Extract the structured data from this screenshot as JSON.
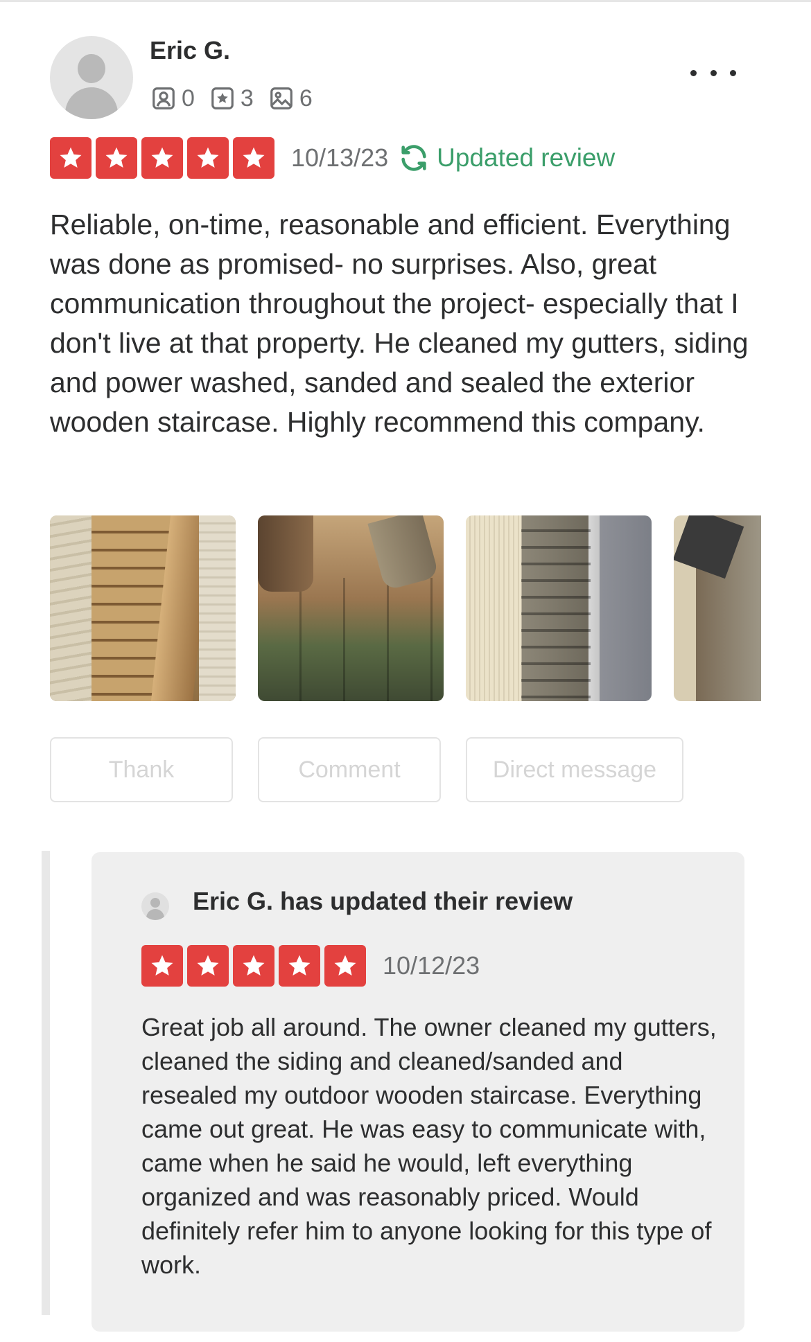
{
  "review": {
    "user": {
      "name": "Eric G.",
      "friends_count": "0",
      "reviews_count": "3",
      "photos_count": "6"
    },
    "rating": 5,
    "date": "10/13/23",
    "updated_label": "Updated review",
    "text": "Reliable, on-time, reasonable and efficient. Everything was done as promised- no surprises. Also, great communication throughout the project- especially that I don't live at that property. He cleaned my gutters, siding and power washed, sanded and sealed the exterior wooden staircase. Highly recommend this company.",
    "actions": {
      "thank": "Thank",
      "comment": "Comment",
      "direct_message": "Direct message"
    }
  },
  "previous_review": {
    "title": "Eric G. has updated their review",
    "rating": 5,
    "date": "10/12/23",
    "text": "Great job all around. The owner cleaned my gutters, cleaned the siding and cleaned/sanded and resealed my outdoor wooden staircase. Everything came out great. He was easy to communicate with, came when he said he would, left everything organized and was reasonably priced. Would definitely refer him to anyone looking for this type of work."
  },
  "colors": {
    "star_red": "#e3413f",
    "updated_green": "#3b9e6a",
    "muted_text": "#6e7072",
    "button_text_disabled": "#d5d5d5"
  },
  "icons": {
    "friends": "friends-icon",
    "reviews": "star-badge-icon",
    "photos": "photo-icon",
    "more": "more-horizontal-icon",
    "updated": "refresh-icon",
    "star": "star-icon"
  }
}
